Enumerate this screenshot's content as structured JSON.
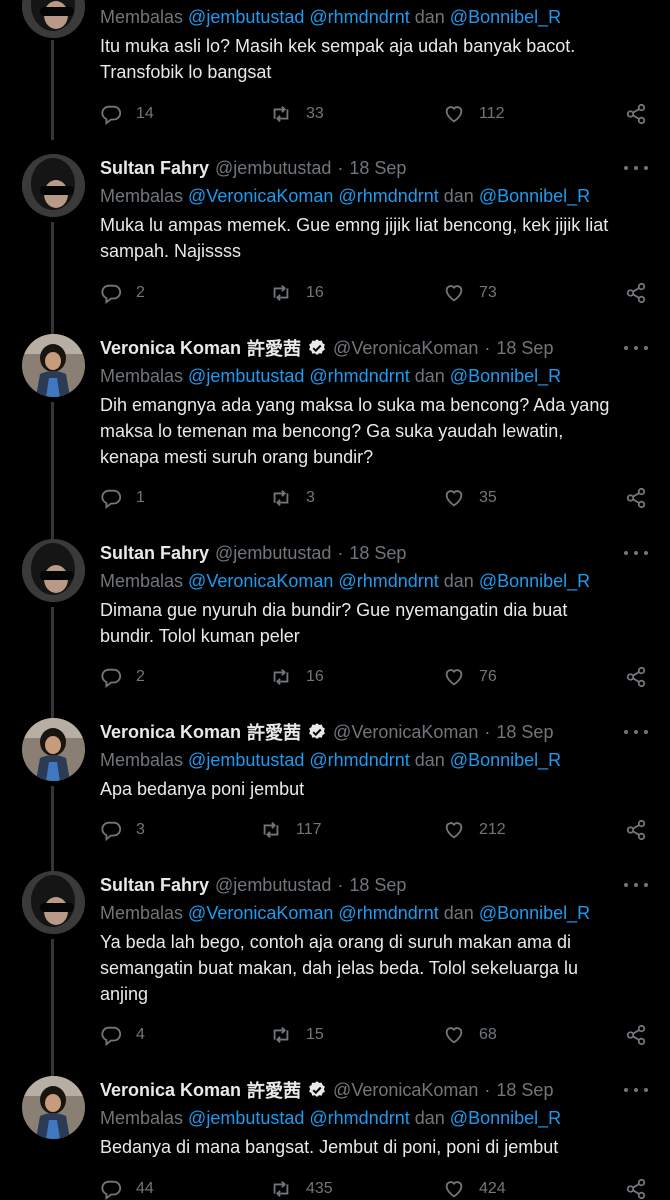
{
  "ui": {
    "replying_prefix": "Membalas",
    "replying_and": "dan",
    "dot": "·",
    "colors": {
      "background": "#000000",
      "text": "#e7e9ea",
      "muted": "#71767b",
      "link": "#1d9bf0"
    }
  },
  "tweets": [
    {
      "author": "",
      "handle": "",
      "time": "",
      "mentions": [
        "@jembutustad",
        "@rhmdndrnt",
        "@Bonnibel_R"
      ],
      "text": "Itu muka asli lo? Masih kek sempak aja udah banyak bacot.\nTransfobik lo bangsat",
      "replies": "14",
      "retweets": "33",
      "likes": "112"
    },
    {
      "author": "Sultan Fahry",
      "handle": "@jembutustad",
      "time": "18 Sep",
      "mentions": [
        "@VeronicaKoman",
        "@rhmdndrnt",
        "@Bonnibel_R"
      ],
      "text": "Muka lu ampas memek. Gue emng jijik liat bencong, kek jijik liat\nsampah. Najissss",
      "replies": "2",
      "retweets": "16",
      "likes": "73"
    },
    {
      "author": "Veronica Koman",
      "author_cjk": "許愛茜",
      "verified": true,
      "handle": "@VeronicaKoman",
      "time": "18 Sep",
      "mentions": [
        "@jembutustad",
        "@rhmdndrnt",
        "@Bonnibel_R"
      ],
      "text": "Dih emangnya ada yang maksa lo suka ma bencong? Ada yang\nmaksa lo temenan ma bencong? Ga suka yaudah lewatin,\nkenapa mesti suruh orang bundir?",
      "replies": "1",
      "retweets": "3",
      "likes": "35"
    },
    {
      "author": "Sultan Fahry",
      "handle": "@jembutustad",
      "time": "18 Sep",
      "mentions": [
        "@VeronicaKoman",
        "@rhmdndrnt",
        "@Bonnibel_R"
      ],
      "text": "Dimana gue nyuruh dia bundir? Gue nyemangatin dia buat\nbundir. Tolol kuman peler",
      "replies": "2",
      "retweets": "16",
      "likes": "76"
    },
    {
      "author": "Veronica Koman",
      "author_cjk": "許愛茜",
      "verified": true,
      "handle": "@VeronicaKoman",
      "time": "18 Sep",
      "mentions": [
        "@jembutustad",
        "@rhmdndrnt",
        "@Bonnibel_R"
      ],
      "text": "Apa bedanya poni jembut",
      "replies": "3",
      "retweets": "117",
      "likes": "212"
    },
    {
      "author": "Sultan Fahry",
      "handle": "@jembutustad",
      "time": "18 Sep",
      "mentions": [
        "@VeronicaKoman",
        "@rhmdndrnt",
        "@Bonnibel_R"
      ],
      "text": "Ya beda lah bego, contoh aja orang di suruh makan ama di\nsemangatin buat makan, dah jelas beda. Tolol sekeluarga lu\nanjing",
      "replies": "4",
      "retweets": "15",
      "likes": "68"
    },
    {
      "author": "Veronica Koman",
      "author_cjk": "許愛茜",
      "verified": true,
      "handle": "@VeronicaKoman",
      "time": "18 Sep",
      "mentions": [
        "@jembutustad",
        "@rhmdndrnt",
        "@Bonnibel_R"
      ],
      "text": "Bedanya di mana bangsat. Jembut di poni, poni di jembut",
      "replies": "44",
      "retweets": "435",
      "likes": "424"
    }
  ]
}
